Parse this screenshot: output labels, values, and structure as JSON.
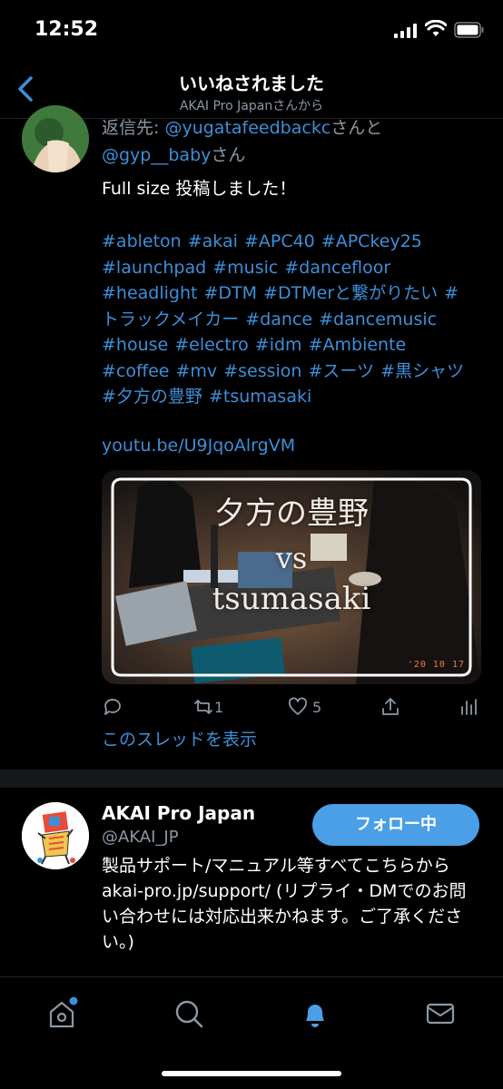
{
  "status": {
    "time": "12:52"
  },
  "nav": {
    "title": "いいねされました",
    "subtitle": "AKAI Pro Japanさんから"
  },
  "tweet": {
    "reply_prefix": "返信先: ",
    "reply_user1": "@yugatafeedbackc",
    "reply_mid": "さんと",
    "reply_user2": "@gyp__baby",
    "reply_suffix": "さん",
    "text": "Full size 投稿しました！",
    "hashtag_lines": [
      "#ableton #akai #APC40 #APCkey25",
      "#launchpad #music #dancefloor",
      "#headlight #DTM #DTMerと繋がりたい #",
      "トラックメイカー #dance #dancemusic",
      "#house #electro #idm #Ambiente",
      "#coffee #mv #session #スーツ #黒シャツ",
      "#夕方の豊野 #tsumasaki"
    ],
    "url": "youtu.be/U9JqoAlrgVM",
    "media": {
      "line1": "夕方の豊野",
      "line2": "vs",
      "line3": "tsumasaki",
      "date_stamp": "'20 10 17"
    },
    "actions": {
      "retweets": "1",
      "likes": "5"
    },
    "show_thread": "このスレッドを表示"
  },
  "profile": {
    "name": "AKAI Pro Japan",
    "handle": "@AKAI_JP",
    "follow_label": "フォロー中",
    "bio": "製品サポート/マニュアル等すべてこちらから akai-pro.jp/support/ (リプライ・DMでのお問い合わせには対応出来かねます。ご了承ください。)"
  },
  "colors": {
    "link": "#3d8fd9",
    "follow_button": "#4a9fe6",
    "muted": "#8b98a5"
  },
  "tabbar": {
    "icons": [
      "home-icon",
      "search-icon",
      "bell-icon",
      "mail-icon"
    ]
  }
}
